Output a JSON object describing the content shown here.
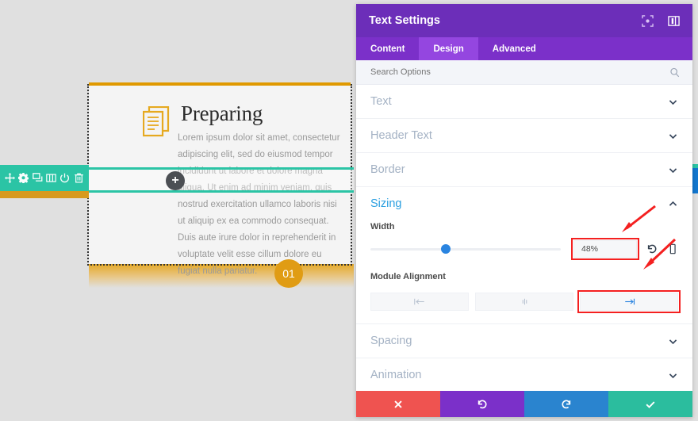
{
  "canvas": {
    "module": {
      "icon": "documents-icon",
      "title": "Preparing",
      "body": "Lorem ipsum dolor sit amet, consectetur adipiscing elit, sed do eiusmod tempor incididunt ut labore et dolore magna aliqua. Ut enim ad minim veniam, quis nostrud exercitation ullamco laboris nisi ut aliquip ex ea commodo consequat. Duis aute irure dolor in reprehenderit in voluptate velit esse cillum dolore eu fugiat nulla pariatur.",
      "badge": "01"
    },
    "row_toolbar": {
      "items": [
        {
          "name": "move-icon",
          "label": "Move"
        },
        {
          "name": "gear-icon",
          "label": "Settings"
        },
        {
          "name": "duplicate-icon",
          "label": "Duplicate"
        },
        {
          "name": "columns-icon",
          "label": "Columns"
        },
        {
          "name": "power-icon",
          "label": "Disable"
        },
        {
          "name": "trash-icon",
          "label": "Delete"
        }
      ]
    },
    "add_button": "+",
    "colors": {
      "row_accent": "#2bc4a5",
      "module_accent": "#e09900",
      "badge": "#e09c14"
    }
  },
  "panel": {
    "title": "Text Settings",
    "header_icons": [
      {
        "name": "focus-icon"
      },
      {
        "name": "layout-toggle-icon"
      }
    ],
    "tabs": [
      {
        "label": "Content",
        "active": false
      },
      {
        "label": "Design",
        "active": true
      },
      {
        "label": "Advanced",
        "active": false
      }
    ],
    "search": {
      "placeholder": "Search Options",
      "value": "",
      "icon": "search-icon"
    },
    "sections": [
      {
        "label": "Text",
        "open": false
      },
      {
        "label": "Header Text",
        "open": false
      },
      {
        "label": "Border",
        "open": false
      },
      {
        "label": "Sizing",
        "open": true
      },
      {
        "label": "Spacing",
        "open": false
      },
      {
        "label": "Animation",
        "open": false
      }
    ],
    "sizing": {
      "width": {
        "label": "Width",
        "value": "48%",
        "slider_percent": 37,
        "reset_icon": "undo-icon",
        "responsive_icon": "mobile-icon"
      },
      "module_alignment": {
        "label": "Module Alignment",
        "options": [
          {
            "name": "align-left",
            "selected": false
          },
          {
            "name": "align-center",
            "selected": false
          },
          {
            "name": "align-right",
            "selected": true
          }
        ]
      }
    },
    "actions": [
      {
        "name": "close-button",
        "icon": "x-icon",
        "color": "#ef5350"
      },
      {
        "name": "undo-button",
        "icon": "undo-icon",
        "color": "#7b30c9"
      },
      {
        "name": "redo-button",
        "icon": "redo-icon",
        "color": "#2a84cf"
      },
      {
        "name": "save-button",
        "icon": "check-icon",
        "color": "#2bbd9e"
      }
    ],
    "colors": {
      "header": "#6c2eb9",
      "tab_active": "#9446e0",
      "accent": "#2a9fe0",
      "annotation": "#f42020"
    }
  }
}
